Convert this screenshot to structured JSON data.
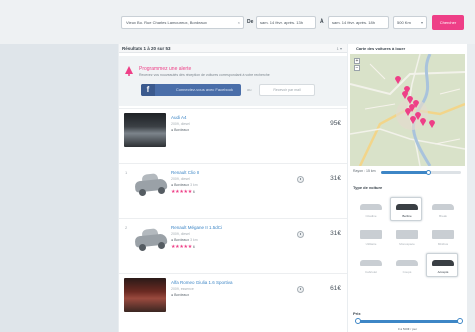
{
  "search": {
    "address": "Vieux Bo. Rue Charles Lamoureux, Bordeaux",
    "from_label": "De",
    "from_value": "sam. 14 févr. après. 13h",
    "to_label": "À",
    "to_value": "sam. 14 févr. après. 18h",
    "distance": "500 Km",
    "submit_label": "Chercher"
  },
  "results": {
    "count_label": "Résultats 1 à 20 sur 53",
    "sort_label": "1 ▾"
  },
  "alert": {
    "title": "Programmez une alerte",
    "description": "Recevez vos nouveautés dès réception de voitures correspondant à votre recherche",
    "facebook_label": "Connectez-vous avec Facebook",
    "or_label": "ou",
    "email_label": "Recevoir par mail"
  },
  "listings": [
    {
      "index": "",
      "name": "Audi A4",
      "subtitle": "2009, diesel",
      "location": "Bordeaux",
      "extra": "",
      "stars": "",
      "review_count": "",
      "price": "95€",
      "thumb": "photo"
    },
    {
      "index": "1",
      "name": "Renault Clio II",
      "subtitle": "2009, diesel",
      "location": "Bordeaux",
      "extra": "3 km",
      "stars": "★★★★★",
      "review_count": "6",
      "price": "31€",
      "thumb": "silhouette"
    },
    {
      "index": "2",
      "name": "Renault Mégane II 1.5dCi",
      "subtitle": "2009, diesel",
      "location": "Bordeaux",
      "extra": "3 km",
      "stars": "★★★★★",
      "review_count": "6",
      "price": "31€",
      "thumb": "silhouette"
    },
    {
      "index": "",
      "name": "Alfa Romeo Giulia 1.6 Sportiva",
      "subtitle": "2009, essence",
      "location": "Bordeaux",
      "extra": "",
      "stars": "",
      "review_count": "",
      "price": "61€",
      "thumb": "photo-red"
    }
  ],
  "map_card": {
    "title": "Carte des voitures à louer",
    "zoom_in": "+",
    "zoom_out": "−",
    "radius_label": "Rayon : 15 km",
    "radius_level": 0.6
  },
  "vehicle_type": {
    "title": "Type de voiture",
    "options": [
      {
        "label": "Citadine",
        "selected": false
      },
      {
        "label": "Berline",
        "selected": true
      },
      {
        "label": "Break",
        "selected": false
      },
      {
        "label": "Utilitaire",
        "selected": false
      },
      {
        "label": "Monospace",
        "selected": false
      },
      {
        "label": "Minibus",
        "selected": false
      },
      {
        "label": "Cabriolet",
        "selected": false
      },
      {
        "label": "Coupé",
        "selected": false
      },
      {
        "label": "Accepté",
        "selected": true
      }
    ]
  },
  "price_filter": {
    "title": "Prix",
    "value_label": "0 à 500€ / jour",
    "range": [
      0,
      1
    ]
  },
  "colors": {
    "accent": "#ee3f87",
    "link": "#3d86c6",
    "facebook": "#4a6ea9"
  }
}
